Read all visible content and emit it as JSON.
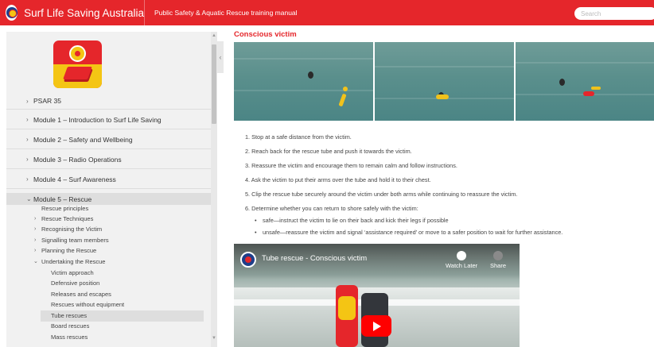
{
  "header": {
    "brand_name": "Surf Life Saving Australia",
    "manual_title": "Public Safety & Aquatic Rescue training manual",
    "search_placeholder": "Search",
    "brand_color": "#e5262b",
    "accent_color": "#f4c514"
  },
  "sidebar": {
    "top_items": [
      {
        "label": "PSAR 35",
        "icon": "chevron-right-icon"
      },
      {
        "label": "Module 1 – Introduction to Surf Life Saving",
        "icon": "chevron-right-icon"
      },
      {
        "label": "Module 2 – Safety and Wellbeing",
        "icon": "chevron-right-icon"
      },
      {
        "label": "Module 3 – Radio Operations",
        "icon": "chevron-right-icon"
      },
      {
        "label": "Module 4 – Surf Awareness",
        "icon": "chevron-right-icon"
      },
      {
        "label": "Module 5 – Rescue",
        "icon": "chevron-down-icon",
        "expanded": true
      }
    ],
    "module5_items": [
      {
        "label": "Rescue principles"
      },
      {
        "label": "Rescue Techniques",
        "icon": "chevron-right-icon"
      },
      {
        "label": "Recognising the Victim",
        "icon": "chevron-right-icon"
      },
      {
        "label": "Signalling team members",
        "icon": "chevron-right-icon"
      },
      {
        "label": "Planning the Rescue",
        "icon": "chevron-right-icon"
      },
      {
        "label": "Undertaking the Rescue",
        "icon": "chevron-down-icon",
        "expanded": true
      }
    ],
    "rescue_items": [
      {
        "label": "Victim approach"
      },
      {
        "label": "Defensive position"
      },
      {
        "label": "Releases and escapes"
      },
      {
        "label": "Rescues without equipment"
      },
      {
        "label": "Tube rescues",
        "selected": true
      },
      {
        "label": "Board rescues"
      },
      {
        "label": "Mass rescues"
      }
    ]
  },
  "main": {
    "section_title": "Conscious victim",
    "steps": [
      "1. Stop at a safe distance from the victim.",
      "2. Reach back for the rescue tube and push it towards the victim.",
      "3. Reassure the victim and encourage them to remain calm and follow instructions.",
      "4. Ask the victim to put their arms over the tube and hold it to their chest.",
      "5. Clip the rescue tube securely around the victim under both arms while continuing to reassure the victim.",
      "6. Determine whether you can return to shore safely with the victim:"
    ],
    "bullets": [
      "safe—instruct the victim to lie on their back and kick their legs if possible",
      "unsafe—reassure the victim and signal ‘assistance required’ or move to a safer position to wait for further assistance."
    ],
    "video": {
      "title": "Tube rescue - Conscious victim",
      "watch_later": "Watch Later",
      "share": "Share"
    }
  }
}
